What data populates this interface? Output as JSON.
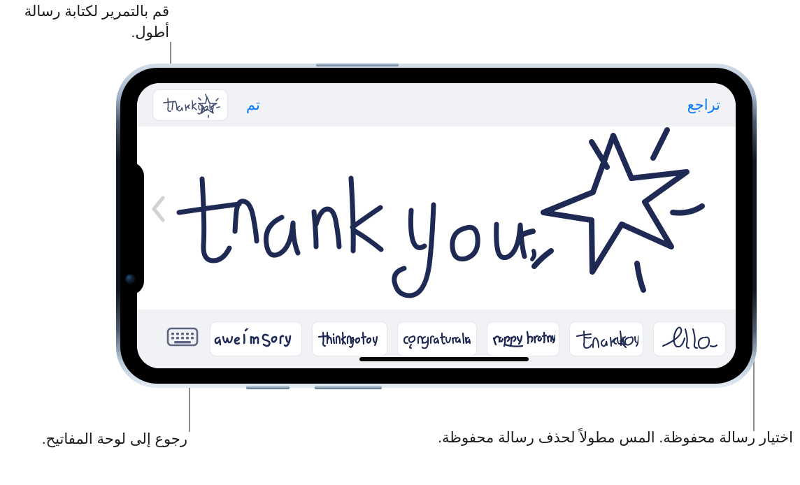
{
  "annotations": {
    "top": "قم بالتمرير لكتابة رسالة أطول.",
    "bottom_left": "رجوع إلى لوحة المفاتيح.",
    "bottom_right": "اختيار رسالة محفوظة. المس مطولاً لحذف رسالة محفوظة."
  },
  "toolbar": {
    "done_label": "تم",
    "undo_label": "تراجع",
    "preview_label": "thank you"
  },
  "canvas": {
    "drawing_text": "thank you",
    "drawing_decoration": "star",
    "ink_color": "#1e2a54",
    "background": "#ffffff"
  },
  "saved_messages": [
    {
      "label": "hello"
    },
    {
      "label": "thank you"
    },
    {
      "label": "happy birthday."
    },
    {
      "label": "congratulations"
    },
    {
      "label": "thinking of you"
    },
    {
      "label": "I'm sorry"
    },
    {
      "label": "awe"
    }
  ],
  "keyboard_button": {
    "label": "keyboard"
  },
  "colors": {
    "accent": "#057afe",
    "toolbar_bg": "#f1f2f5",
    "ink": "#1e2a54",
    "leader": "#8c8c8c",
    "chevron": "#d2d2d4"
  }
}
